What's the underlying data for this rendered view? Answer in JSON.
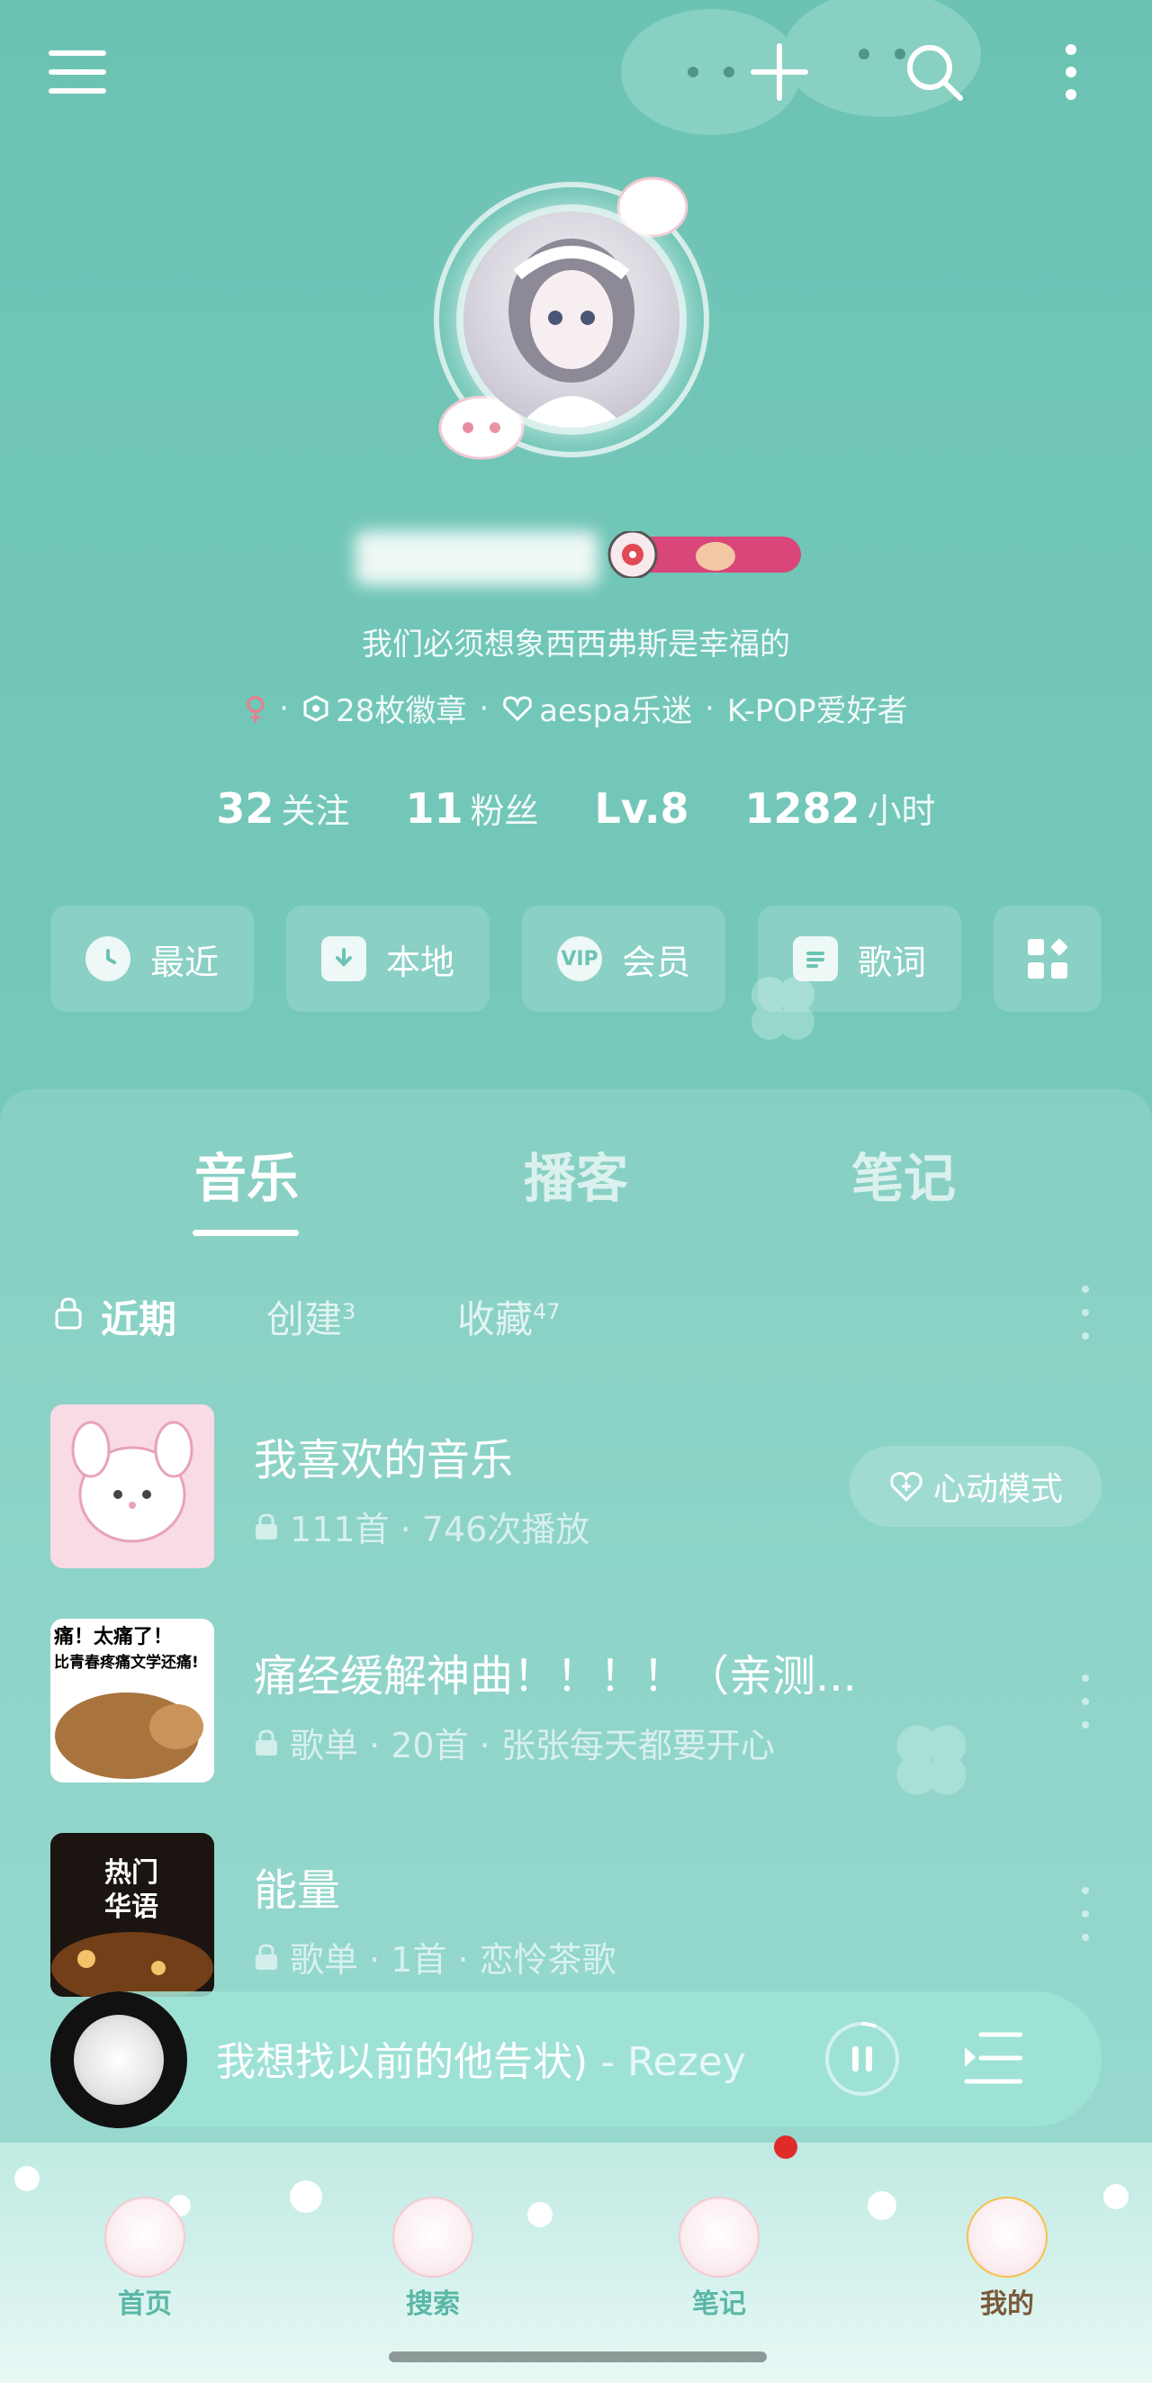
{
  "profile": {
    "bio": "我们必须想象西西弗斯是幸福的",
    "gender_symbol": "♀",
    "badges": "28枚徽章",
    "fan_tag": "aespa乐迷",
    "genre_tag": "K-POP爱好者",
    "separator": "·"
  },
  "stats": [
    {
      "num": "32",
      "label": "关注"
    },
    {
      "num": "11",
      "label": "粉丝"
    },
    {
      "num": "Lv.8",
      "label": ""
    },
    {
      "num": "1282",
      "label": "小时"
    }
  ],
  "quick_actions": {
    "recent": "最近",
    "local": "本地",
    "vip": "会员",
    "vip_icon": "VIP",
    "lyrics": "歌词"
  },
  "tabs": {
    "music": "音乐",
    "podcast": "播客",
    "notes": "笔记"
  },
  "subtabs": {
    "recent": "近期",
    "created": "创建",
    "created_count": "3",
    "collected": "收藏",
    "collected_count": "47"
  },
  "playlists": [
    {
      "title": "我喜欢的音乐",
      "sub": "111首 · 746次播放",
      "action": "心动模式"
    },
    {
      "title": "痛经缓解神曲！！！！（亲测...",
      "sub": "歌单 · 20首 · 张张每天都要开心",
      "thumb_text1": "痛！太痛了！",
      "thumb_text2": "比青春疼痛文学还痛!"
    },
    {
      "title": "能量",
      "sub": "歌单 · 1首 · 恋怜茶歌",
      "thumb_text": "热门\n华语"
    }
  ],
  "player": {
    "song": "我想找以前的他告状)",
    "artist": " - Rezey"
  },
  "nav": {
    "home": "首页",
    "search": "搜索",
    "notes": "笔记",
    "mine": "我的"
  },
  "colors": {
    "bg": "#6cc3b4",
    "accent_red": "#e02b2b",
    "nav_label": "#5ab7a6"
  }
}
